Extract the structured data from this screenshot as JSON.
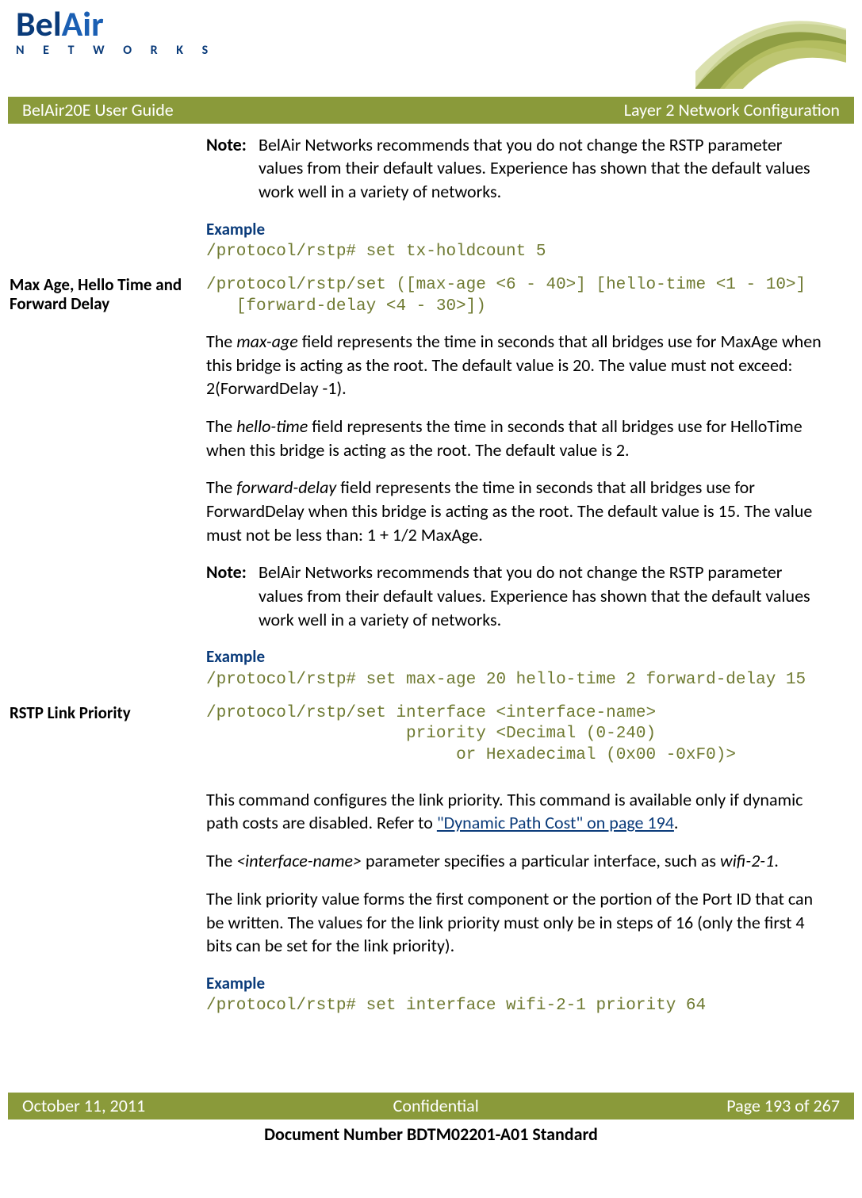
{
  "header": {
    "logo_bel": "Bel",
    "logo_air": "Air",
    "logo_networks": "N E T W O R K S"
  },
  "title_bar": {
    "left": "BelAir20E User Guide",
    "right": "Layer 2 Network Configuration"
  },
  "body": {
    "note1_label": "Note:",
    "note1_body": "BelAir Networks recommends that you do not change the RSTP parameter values from their default values. Experience has shown that the default values work well in a variety of networks.",
    "example1_label": "Example",
    "example1_code": "/protocol/rstp# set tx-holdcount 5",
    "heading1": "Max Age, Hello Time and Forward Delay",
    "syntax1": "/protocol/rstp/set ([max-age <6 - 40>] [hello-time <1 - 10>]\n   [forward-delay <4 - 30>])",
    "para1a": "The ",
    "para1b_ital": "max-age",
    "para1c": " field represents the time in seconds that all bridges use for MaxAge when this bridge is acting as the root. The default value is 20. The value must not exceed: 2(ForwardDelay -1).",
    "para2a": "The ",
    "para2b_ital": "hello-time",
    "para2c": " field represents the time in seconds that all bridges use for HelloTime when this bridge is acting as the root. The default value is 2.",
    "para3a": "The ",
    "para3b_ital": "forward-delay",
    "para3c": " field represents the time in seconds that all bridges use for ForwardDelay when this bridge is acting as the root. The default value is 15. The value must not be less than: 1 + 1/2 MaxAge.",
    "note2_label": "Note:",
    "note2_body": "BelAir Networks recommends that you do not change the RSTP parameter values from their default values. Experience has shown that the default values work well in a variety of networks.",
    "example2_label": "Example",
    "example2_code": "/protocol/rstp# set max-age 20 hello-time 2 forward-delay 15",
    "heading2": "RSTP Link Priority",
    "syntax2": "/protocol/rstp/set interface <interface-name>\n                    priority <Decimal (0-240)\n                         or Hexadecimal (0x00 -0xF0)>",
    "para4a": "This command configures the link priority. This command is available only if dynamic path costs are disabled. Refer to ",
    "para4_link": "\"Dynamic Path Cost\" on page 194",
    "para4b": ".",
    "para5a": "The ",
    "para5b_ital": "<interface-name>",
    "para5c": " parameter specifies a particular interface, such as ",
    "para5d_ital": "wifi-2-1",
    "para5e": ".",
    "para6": "The link priority value forms the first component or the portion of the Port ID that can be written. The values for the link priority must only be in steps of 16 (only the first 4 bits can be set for the link priority).",
    "example3_label": "Example",
    "example3_code": "/protocol/rstp# set interface wifi-2-1 priority 64"
  },
  "footer": {
    "date": "October 11, 2011",
    "conf": "Confidential",
    "page": "Page 193 of 267",
    "docnum": "Document Number BDTM02201-A01 Standard"
  }
}
